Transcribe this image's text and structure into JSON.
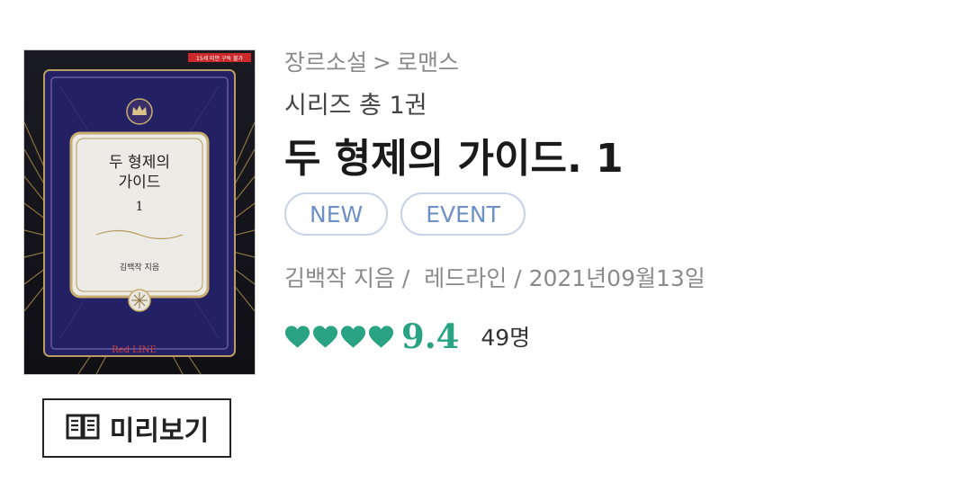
{
  "cover": {
    "age_badge": "15세 미만 구독 불가",
    "title_line1": "두 형제의",
    "title_line2": "가이드",
    "volume": "1",
    "author_line": "김백작 지음",
    "publisher_logo": "Red LINE"
  },
  "preview": {
    "label": "미리보기",
    "icon": "book-icon"
  },
  "breadcrumb": {
    "genre": "장르소설",
    "separator": ">",
    "sub": "로맨스"
  },
  "series": {
    "text": "시리즈 총 1권"
  },
  "title": "두 형제의 가이드. 1",
  "badges": [
    "NEW",
    "EVENT"
  ],
  "meta": {
    "author": "김백작 지음 /",
    "publisher": "레드라인 /",
    "date": "2021년09월13일"
  },
  "rating": {
    "hearts": 4,
    "score": "9.4",
    "count": "49명",
    "color": "#2aa382"
  }
}
